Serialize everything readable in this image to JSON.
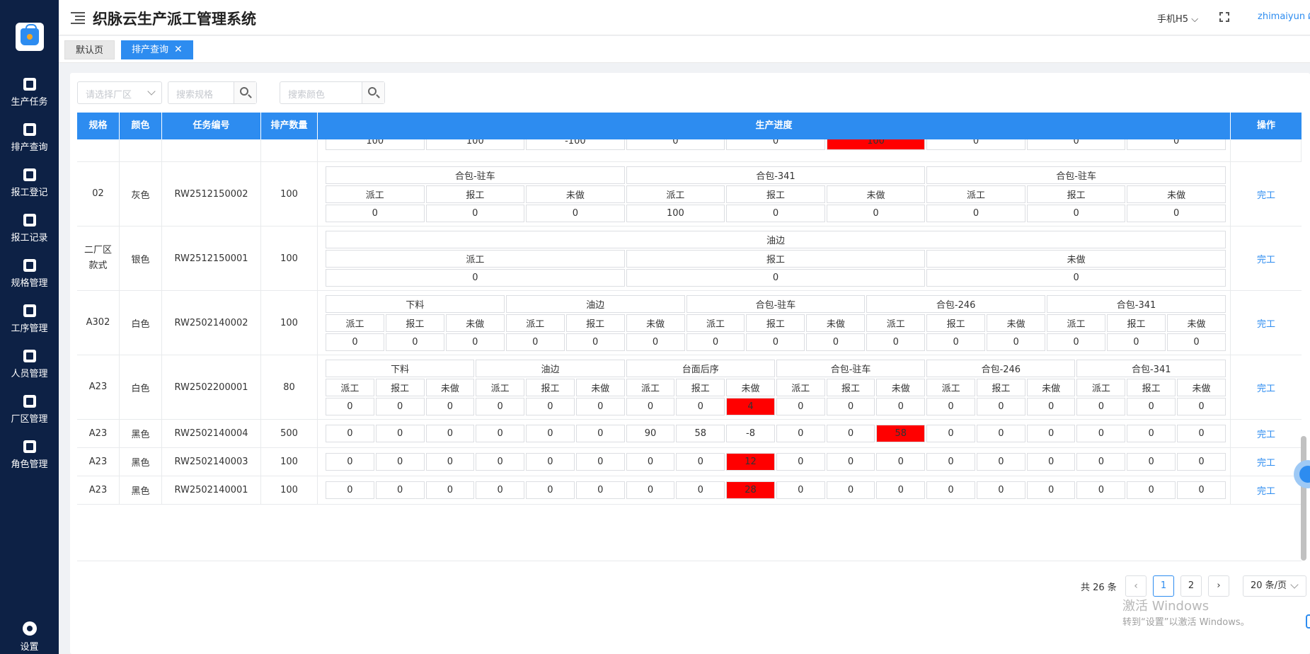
{
  "app": {
    "title": "织脉云生产派工管理系统",
    "mobile_label": "手机H5",
    "username": "zhimaiyun"
  },
  "sidebar": {
    "items": [
      {
        "label": "生产任务",
        "icon": "task-icon"
      },
      {
        "label": "排产查询",
        "icon": "search-doc-icon"
      },
      {
        "label": "报工登记",
        "icon": "edit-icon"
      },
      {
        "label": "报工记录",
        "icon": "record-icon"
      },
      {
        "label": "规格管理",
        "icon": "shirt-icon"
      },
      {
        "label": "工序管理",
        "icon": "process-icon"
      },
      {
        "label": "人员管理",
        "icon": "users-icon"
      },
      {
        "label": "厂区管理",
        "icon": "factory-icon"
      },
      {
        "label": "角色管理",
        "icon": "role-icon"
      }
    ],
    "settings_label": "设置"
  },
  "tabs": [
    {
      "label": "默认页",
      "active": false
    },
    {
      "label": "排产查询",
      "active": true
    }
  ],
  "filters": {
    "factory_placeholder": "请选择厂区",
    "spec_placeholder": "搜索规格",
    "color_placeholder": "搜索颜色"
  },
  "table": {
    "headers": [
      "规格",
      "颜色",
      "任务编号",
      "排产数量",
      "生产进度",
      "操作"
    ],
    "op_label": "完工",
    "sub_labels": [
      "派工",
      "报工",
      "未做"
    ],
    "partial_row": {
      "values": [
        "100",
        "100",
        "-100",
        "0",
        "0",
        "100",
        "0",
        "0",
        "0"
      ],
      "red": [
        5
      ]
    },
    "rows": [
      {
        "spec": "02",
        "color": "灰色",
        "task_no": "RW2512150002",
        "qty": "100",
        "processes": [
          "合包-驻车",
          "合包-341",
          "合包-驻车"
        ],
        "values": [
          "0",
          "0",
          "0",
          "100",
          "0",
          "0",
          "0",
          "0",
          "0"
        ],
        "red": []
      },
      {
        "spec": "二厂区款式",
        "color": "银色",
        "task_no": "RW2512150001",
        "qty": "100",
        "processes": [
          "油边"
        ],
        "values": [
          "0",
          "0",
          "0"
        ],
        "red": []
      },
      {
        "spec": "A302",
        "color": "白色",
        "task_no": "RW2502140002",
        "qty": "100",
        "processes": [
          "下料",
          "油边",
          "合包-驻车",
          "合包-246",
          "合包-341"
        ],
        "values": [
          "0",
          "0",
          "0",
          "0",
          "0",
          "0",
          "0",
          "0",
          "0",
          "0",
          "0",
          "0",
          "0",
          "0",
          "0"
        ],
        "red": []
      },
      {
        "spec": "A23",
        "color": "白色",
        "task_no": "RW2502200001",
        "qty": "80",
        "processes": [
          "下料",
          "油边",
          "台面后序",
          "合包-驻车",
          "合包-246",
          "合包-341"
        ],
        "values": [
          "0",
          "0",
          "0",
          "0",
          "0",
          "0",
          "0",
          "0",
          "4",
          "0",
          "0",
          "0",
          "0",
          "0",
          "0",
          "0",
          "0",
          "0"
        ],
        "red": [
          8
        ]
      },
      {
        "spec": "A23",
        "color": "黑色",
        "task_no": "RW2502140004",
        "qty": "500",
        "processes": [],
        "values": [
          "0",
          "0",
          "0",
          "0",
          "0",
          "0",
          "90",
          "58",
          "-8",
          "0",
          "0",
          "58",
          "0",
          "0",
          "0",
          "0",
          "0",
          "0"
        ],
        "red": [
          11
        ]
      },
      {
        "spec": "A23",
        "color": "黑色",
        "task_no": "RW2502140003",
        "qty": "100",
        "processes": [],
        "values": [
          "0",
          "0",
          "0",
          "0",
          "0",
          "0",
          "0",
          "0",
          "12",
          "0",
          "0",
          "0",
          "0",
          "0",
          "0",
          "0",
          "0",
          "0"
        ],
        "red": [
          8
        ]
      },
      {
        "spec": "A23",
        "color": "黑色",
        "task_no": "RW2502140001",
        "qty": "100",
        "processes": [],
        "values": [
          "0",
          "0",
          "0",
          "0",
          "0",
          "0",
          "0",
          "0",
          "28",
          "0",
          "0",
          "0",
          "0",
          "0",
          "0",
          "0",
          "0",
          "0"
        ],
        "red": [
          8
        ]
      }
    ]
  },
  "pagination": {
    "total_label": "共 26 条",
    "pages": [
      "1",
      "2"
    ],
    "current": "1",
    "page_size_label": "20 条/页"
  },
  "watermark": {
    "title": "激活 Windows",
    "subtitle": "转到“设置”以激活 Windows。"
  }
}
